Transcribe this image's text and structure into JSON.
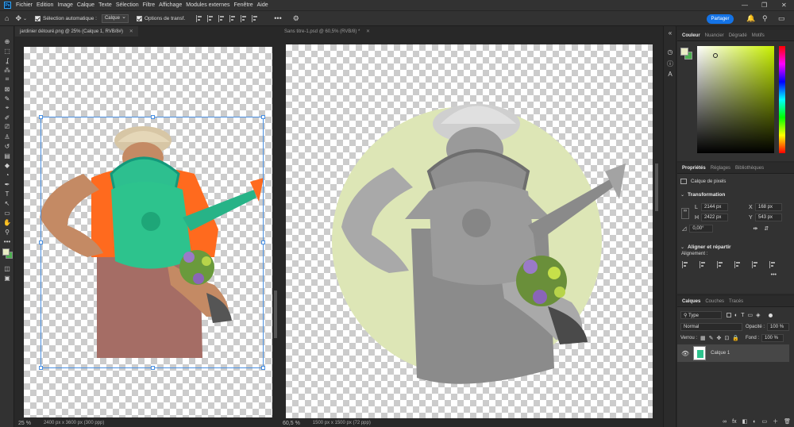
{
  "menubar": {
    "logo": "Ps",
    "items": [
      "Fichier",
      "Edition",
      "Image",
      "Calque",
      "Texte",
      "Sélection",
      "Filtre",
      "Affichage",
      "Modules externes",
      "Fenêtre",
      "Aide"
    ],
    "controls": [
      "—",
      "❐",
      "✕"
    ]
  },
  "options": {
    "auto_select_label": "Sélection automatique :",
    "auto_select_target": "Calque",
    "transform_label": "Options de transf.",
    "more": "•••",
    "share_label": "Partager"
  },
  "doc_left": {
    "tab_title": "jardinier détouré.png @ 25% (Calque 1, RVB/8#)",
    "zoom": "25 %",
    "info": "2400 px x 3600 px (300 ppp)"
  },
  "doc_right": {
    "tab_title": "Sans titre-1.psd @ 60,5% (RVB/8) *",
    "zoom": "60,5 %",
    "info": "1500 px x 1500 px (72 ppp)"
  },
  "color_panel": {
    "tabs": [
      "Couleur",
      "Nuancier",
      "Dégradé",
      "Motifs"
    ],
    "foreground": "#e8ecc4",
    "background": "#4caf50",
    "hue_color": "#c8f000"
  },
  "properties_panel": {
    "tabs": [
      "Propriétés",
      "Réglages",
      "Bibliothèques"
    ],
    "layer_type": "Calque de pixels",
    "transform_title": "Transformation",
    "w_label": "L",
    "w_value": "2144 px",
    "h_label": "H",
    "h_value": "2422 px",
    "x_label": "X",
    "x_value": "168 px",
    "y_label": "Y",
    "y_value": "543 px",
    "angle_value": "0,00°",
    "align_title": "Aligner et répartir",
    "align_sub": "Alignement :"
  },
  "layers_panel": {
    "tabs": [
      "Calques",
      "Couches",
      "Tracés"
    ],
    "filter_type": "Type",
    "blend_mode": "Normal",
    "opacity_label": "Opacité :",
    "opacity_value": "100 %",
    "lock_label": "Verrou :",
    "fill_label": "Fond :",
    "fill_value": "100 %",
    "layer_name": "Calque 1",
    "footer_icons": [
      "∞",
      "fx",
      "◧",
      "◐",
      "▭",
      "＋",
      "🗑"
    ]
  },
  "tools": [
    "⊕",
    "⬚",
    "ʆ",
    "⁂",
    "⌗",
    "⊠",
    "✎",
    "⌖",
    "✐",
    "⎚",
    "♙",
    "↺",
    "▤",
    "◆",
    "◔",
    "✒",
    "T",
    "↖",
    "▭",
    "✋",
    "⚲",
    "•••"
  ]
}
